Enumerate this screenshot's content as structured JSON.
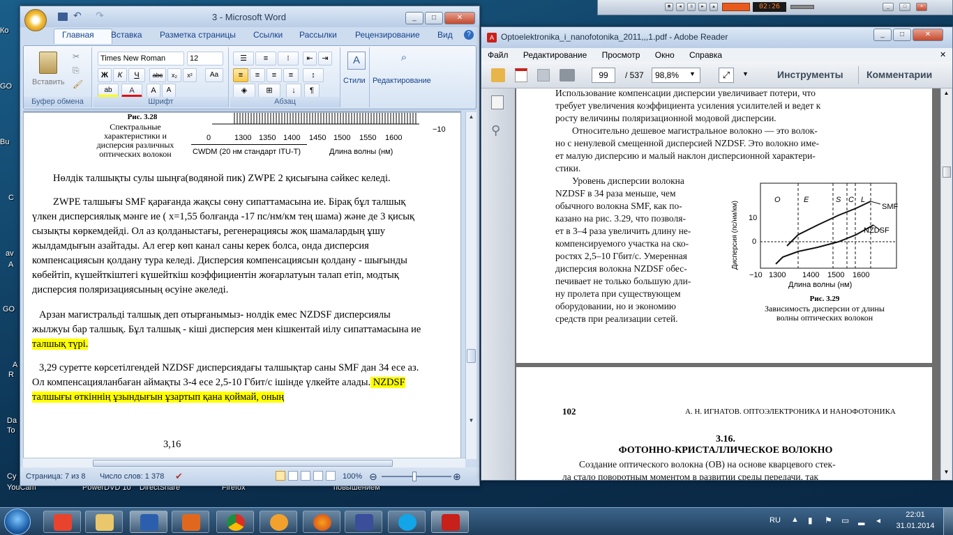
{
  "desktop": {
    "icons": [
      "Ко",
      "GO",
      "Bu",
      "C",
      "av",
      "A",
      "GO",
      "A",
      "R",
      "Da",
      "To",
      "Су",
      "YouCam",
      "PowerDVD 10",
      "DirectShare",
      "Firefox",
      "повышением"
    ]
  },
  "media_player": {
    "time": "02:26"
  },
  "word": {
    "title": "3 - Microsoft Word",
    "tabs": [
      "Главная",
      "Вставка",
      "Разметка страницы",
      "Ссылки",
      "Рассылки",
      "Рецензирование",
      "Вид"
    ],
    "font_name": "Times New Roman",
    "font_size": "12",
    "paste_label": "Вставить",
    "styles_label": "Стили",
    "editing_label": "Редактирование",
    "groups": [
      "Буфер обмена",
      "Шрифт",
      "Абзац"
    ],
    "figure": {
      "caption_num": "Рис. 3.28",
      "caption_lines": [
        "Спектральные",
        "характеристики и",
        "дисперсия различных",
        "оптических волокон"
      ],
      "axis_ticks": [
        "0",
        "1300",
        "1350",
        "1400",
        "1450",
        "1500",
        "1550",
        "1600"
      ],
      "minus_label": "−10",
      "cwdm": "CWDM (20 нм стандарт ITU-T)",
      "wavelength": "Длина волны (нм)"
    },
    "paragraphs": [
      "Нөлдік талшықты сулы шыңға(водяной пик) ZWPE 2 қисығына сәйкес келеді.",
      "ZWPE талшығы  SMF қарағанда жақсы сөну  сипаттамасына ие. Бірақ бұл талшық",
      "үлкен дисперсиялық мәнге ие ( х=1,55 болғанда -17 пс/нм/км  тең шама) және де 3 қисық",
      "сызықты көркемдейді.  Ол аз қолданыстағы,  регенерациясы жоқ шамалардың ұшу",
      "жылдамдығын азайтады. Ал егер көп канал саны керек болса, онда дисперсия",
      "компенсациясын қолдану тура келеді.  Дисперсия компенсациясын қолдану - шығынды",
      "көбейтіп,  күшейткіштегі күшейткіш коэффициентін жоғарлатуын талап етіп, модтық",
      "дисперсия поляризациясының өсуіне әкеледі.",
      "Арзан магистральді талшық деп отырғанымыз- нолдік емес  NZDSF дисперсиялы",
      "жылжуы бар  талшық. Бұл талшық - кіші дисперсия мен кішкентай иілу сипаттамасына ие",
      "талшық түрі.",
      "3,29 суретте көрсетілгендей NZDSF дисперсиядағы талшықтар саны SMF дан 34 есе аз.",
      "Ол компенсацияланбаған аймақты 3-4 есе 2,5-10 Гбит/с ішінде үлкейте алады.",
      " NZDSF",
      "талшығы өткіннің ұзындығын  ұзартып қана қоймай, оның"
    ],
    "page_number_text": "3,16",
    "status": {
      "page": "Страница: 7 из 8",
      "words": "Число слов: 1 378",
      "zoom": "100%"
    }
  },
  "adobe": {
    "title": "Optoelektronika_i_nanofotonika_2011,,,1.pdf - Adobe Reader",
    "menu": [
      "Файл",
      "Редактирование",
      "Просмотр",
      "Окно",
      "Справка"
    ],
    "page_current": "99",
    "page_total": "/ 537",
    "zoom": "98,8%",
    "tools_label": "Инструменты",
    "comments_label": "Комментарии",
    "page1_lines": [
      "Использование компенсации дисперсии увеличивает потери, что",
      "требует увеличения коэффициента усиления усилителей и ведет к",
      "росту величины поляризационной модовой дисперсии.",
      "Относительно дешевое магистральное волокно — это волок-",
      "но с ненулевой смещенной дисперсией NZDSF. Это волокно име-",
      "ет малую дисперсию и малый наклон дисперсионной характери-",
      "стики."
    ],
    "page1_col": [
      "Уровень дисперсии волокна",
      "NZDSF в 34 раза меньше, чем",
      "обычного волокна SMF, как по-",
      "казано на рис. 3.29, что позволя-",
      "ет в 3–4 раза увеличить длину не-",
      "компенсируемого участка на ско-",
      "ростях 2,5–10 Гбит/с. Умеренная",
      "дисперсия волокна NZDSF обес-",
      "печивает не только большую дли-",
      "ну пролета при существующем",
      "оборудовании, но и экономию",
      "средств при реализации сетей."
    ],
    "fig": {
      "ylabel": "Дисперсия (пс/нм/км)",
      "xlabel": "Длина волны (нм)",
      "yticks": [
        "10",
        "0",
        "−10"
      ],
      "xticks": [
        "1300",
        "1400",
        "1500",
        "1600"
      ],
      "bands": [
        "O",
        "E",
        "S",
        "C",
        "L"
      ],
      "smf": "SMF",
      "nzdsf": "NZDSF",
      "caption_num": "Рис. 3.29",
      "caption": [
        "Зависимость дисперсии от длины",
        "волны оптических волокон"
      ]
    },
    "page2": {
      "num": "102",
      "header": "А. Н. ИГНАТОВ. ОПТОЭЛЕКТРОНИКА И НАНОФОТОНИКА",
      "section": "3.16.",
      "heading": "ФОТОННО-КРИСТАЛЛИЧЕСКОЕ ВОЛОКНО",
      "line1": "Создание оптического волокна (ОВ) на основе кварцевого стек-",
      "line2": "ла стало поворотным моментом в развитии среды передачи, так"
    }
  },
  "taskbar": {
    "lang": "RU",
    "time": "22:01",
    "date": "31.01.2014"
  }
}
